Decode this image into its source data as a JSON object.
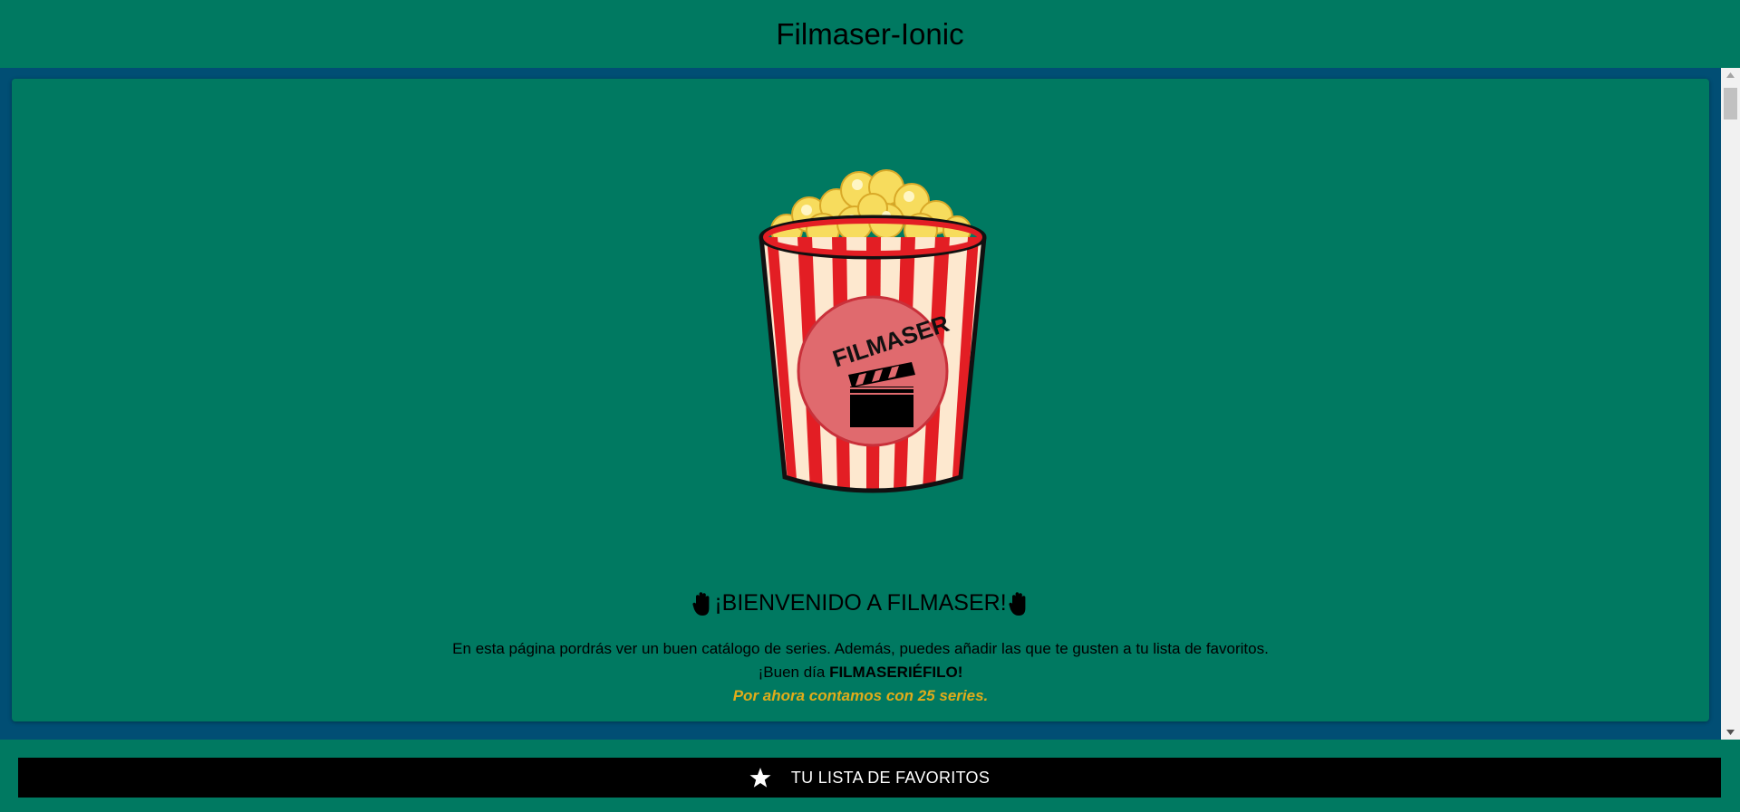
{
  "header": {
    "title": "Filmaser-Ionic"
  },
  "logo": {
    "text": "FILMASER"
  },
  "welcome": {
    "title": "¡BIENVENIDO A FILMASER!",
    "description": "En esta página pordrás ver un buen catálogo de series. Además, puedes añadir las que te gusten a tu lista de favoritos.",
    "greeting_prefix": "¡Buen día ",
    "greeting_name": "FILMASERIÉFILO!",
    "series_count": "Por ahora contamos con 25 series."
  },
  "footer": {
    "favorites_label": "TU LISTA DE FAVORITOS",
    "favorites_icon": "star-icon"
  },
  "colors": {
    "primary": "#007961",
    "background": "#014e74",
    "accent": "#e0ac1a"
  }
}
